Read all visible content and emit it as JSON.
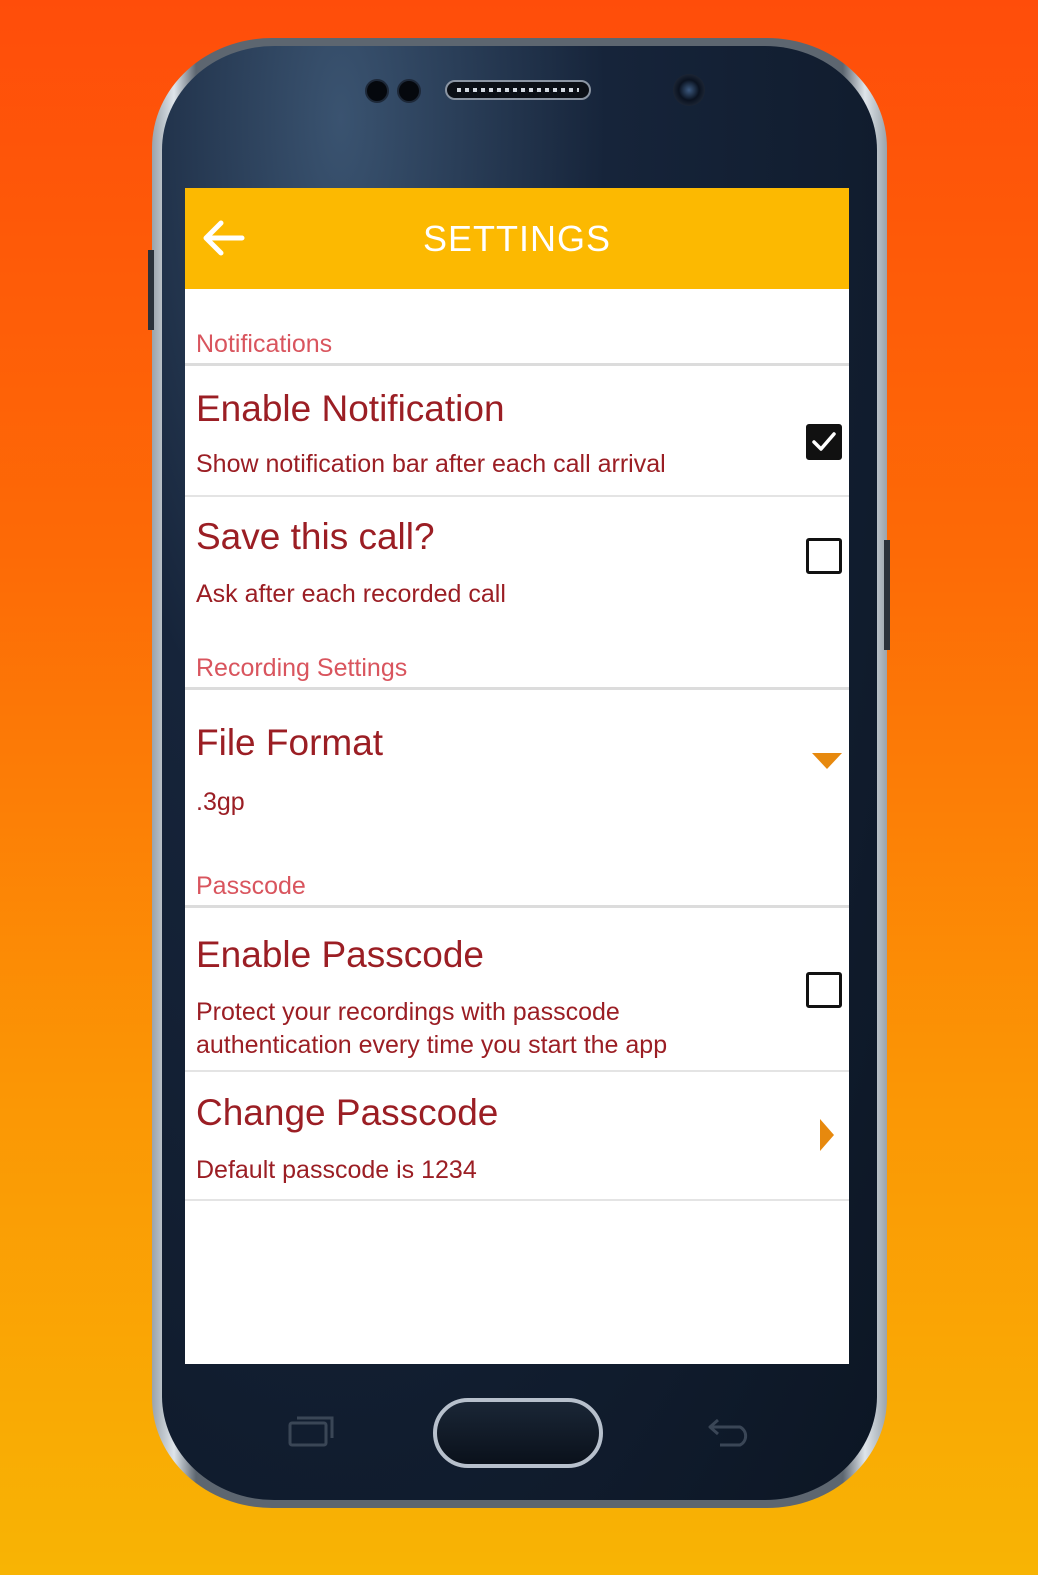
{
  "app": {
    "title": "SETTINGS",
    "accent_color": "#fcb901",
    "text_color": "#9b1e24",
    "section_color": "#d9555e",
    "back_icon": "arrow-left-icon"
  },
  "sections": {
    "notifications": {
      "header": "Notifications",
      "enable_notification": {
        "title": "Enable Notification",
        "subtitle": "Show notification bar after each call arrival",
        "checked": true
      },
      "save_call": {
        "title": "Save this call?",
        "subtitle": "Ask after each recorded call",
        "checked": false
      }
    },
    "recording": {
      "header": "Recording Settings",
      "file_format": {
        "title": "File Format",
        "value": ".3gp",
        "control_icon": "dropdown-triangle-icon"
      }
    },
    "passcode": {
      "header": "Passcode",
      "enable_passcode": {
        "title": "Enable Passcode",
        "subtitle_line1": "Protect your recordings with  passcode",
        "subtitle_line2": "authentication every time you start the app",
        "checked": false
      },
      "change_passcode": {
        "title": "Change Passcode",
        "subtitle": "Default passcode is 1234",
        "control_icon": "chevron-right-icon"
      }
    }
  },
  "device": {
    "nav_keys": [
      "recents-icon",
      "home-button",
      "back-key-icon"
    ]
  }
}
